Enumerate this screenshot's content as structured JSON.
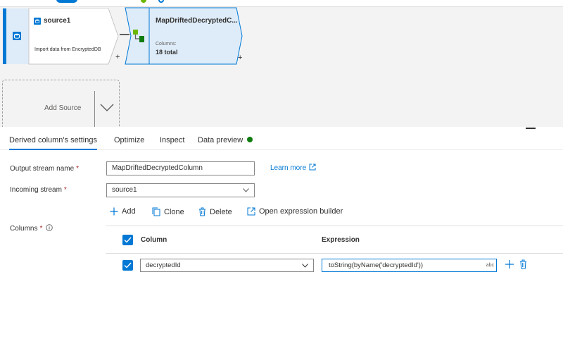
{
  "canvas": {
    "source_node": {
      "title": "source1",
      "description": "Import data from EncryptedDB",
      "add_label": "+"
    },
    "derived_node": {
      "title": "MapDriftedDecryptedC...",
      "columns_label": "Columns:",
      "columns_value": "18 total",
      "add_label": "+"
    },
    "add_source_label": "Add Source"
  },
  "tabs": [
    {
      "label": "Derived column's settings",
      "active": true
    },
    {
      "label": "Optimize",
      "active": false
    },
    {
      "label": "Inspect",
      "active": false
    },
    {
      "label": "Data preview",
      "active": false,
      "status_color": "#107c10"
    }
  ],
  "form": {
    "output_stream": {
      "label": "Output stream name",
      "required_mark": "*",
      "value": "MapDriftedDecryptedColumn"
    },
    "learn_more": "Learn more",
    "incoming_stream": {
      "label": "Incoming stream",
      "required_mark": "*",
      "value": "source1"
    },
    "columns": {
      "label": "Columns",
      "required_mark": "*"
    }
  },
  "toolbar": {
    "add": "Add",
    "clone": "Clone",
    "delete": "Delete",
    "open_builder": "Open expression builder"
  },
  "grid": {
    "header_column": "Column",
    "header_expression": "Expression",
    "rows": [
      {
        "column": "decryptedId",
        "expression": "toString(byName('decryptedId'))",
        "type_badge": "abc"
      }
    ]
  },
  "colors": {
    "accent": "#0078d4",
    "node_fill": "#deecf9",
    "canvas_bg": "#f3f3f3"
  }
}
